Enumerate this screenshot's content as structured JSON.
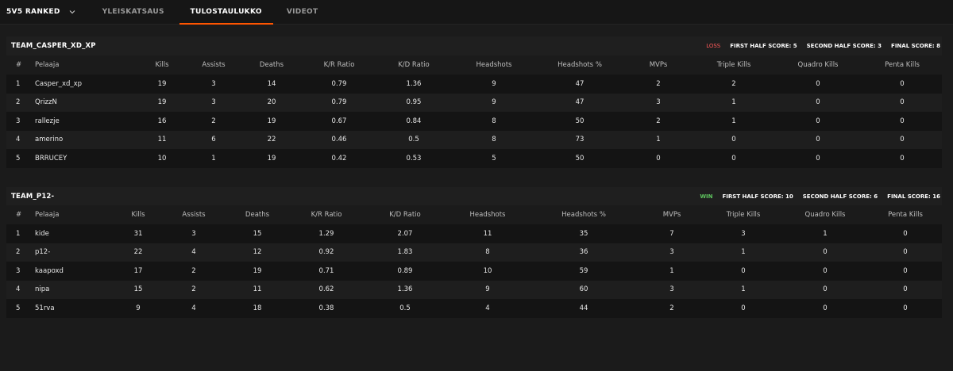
{
  "nav": {
    "mode_label": "5V5 RANKED",
    "tabs": [
      "YLEISKATSAUS",
      "TULOSTAULUKKO",
      "VIDEOT"
    ],
    "active_tab": "TULOSTAULUKKO"
  },
  "columns": [
    "#",
    "Pelaaja",
    "Kills",
    "Assists",
    "Deaths",
    "K/R Ratio",
    "K/D Ratio",
    "Headshots",
    "Headshots %",
    "MVPs",
    "Triple Kills",
    "Quadro Kills",
    "Penta Kills"
  ],
  "teams": [
    {
      "name": "TEAM_CASPER_XD_XP",
      "result": "LOSS",
      "first_half": "FIRST HALF SCORE: 5",
      "second_half": "SECOND HALF SCORE: 3",
      "final": "FINAL SCORE: 8",
      "players": [
        [
          "1",
          "Casper_xd_xp",
          "19",
          "3",
          "14",
          "0.79",
          "1.36",
          "9",
          "47",
          "2",
          "2",
          "0",
          "0"
        ],
        [
          "2",
          "QrizzN",
          "19",
          "3",
          "20",
          "0.79",
          "0.95",
          "9",
          "47",
          "3",
          "1",
          "0",
          "0"
        ],
        [
          "3",
          "rallezje",
          "16",
          "2",
          "19",
          "0.67",
          "0.84",
          "8",
          "50",
          "2",
          "1",
          "0",
          "0"
        ],
        [
          "4",
          "amerino",
          "11",
          "6",
          "22",
          "0.46",
          "0.5",
          "8",
          "73",
          "1",
          "0",
          "0",
          "0"
        ],
        [
          "5",
          "BRRUCEY",
          "10",
          "1",
          "19",
          "0.42",
          "0.53",
          "5",
          "50",
          "0",
          "0",
          "0",
          "0"
        ]
      ]
    },
    {
      "name": "TEAM_P12-",
      "result": "WIN",
      "first_half": "FIRST HALF SCORE: 10",
      "second_half": "SECOND HALF SCORE: 6",
      "final": "FINAL SCORE: 16",
      "players": [
        [
          "1",
          "kide",
          "31",
          "3",
          "15",
          "1.29",
          "2.07",
          "11",
          "35",
          "7",
          "3",
          "1",
          "0"
        ],
        [
          "2",
          "p12-",
          "22",
          "4",
          "12",
          "0.92",
          "1.83",
          "8",
          "36",
          "3",
          "1",
          "0",
          "0"
        ],
        [
          "3",
          "kaapoxd",
          "17",
          "2",
          "19",
          "0.71",
          "0.89",
          "10",
          "59",
          "1",
          "0",
          "0",
          "0"
        ],
        [
          "4",
          "nipa",
          "15",
          "2",
          "11",
          "0.62",
          "1.36",
          "9",
          "60",
          "3",
          "1",
          "0",
          "0"
        ],
        [
          "5",
          "51rva",
          "9",
          "4",
          "18",
          "0.38",
          "0.5",
          "4",
          "44",
          "2",
          "0",
          "0",
          "0"
        ]
      ]
    }
  ],
  "colors": {
    "accent": "#ff5500",
    "loss": "#ff5a5a",
    "win": "#5fc65f",
    "background": "#1b1b1b"
  }
}
